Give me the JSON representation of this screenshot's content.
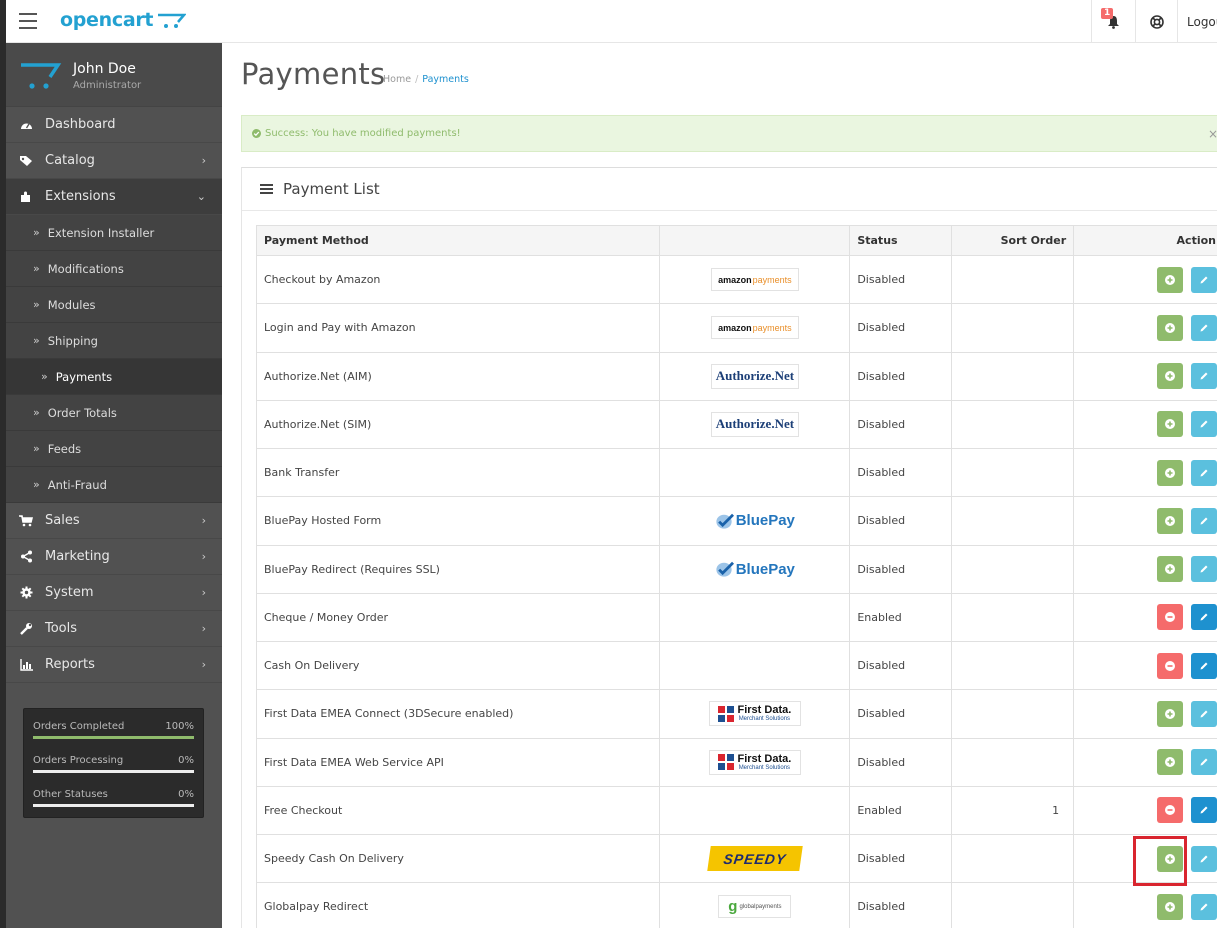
{
  "header": {
    "logo_text": "opencart",
    "notification_count": "1",
    "logout_label": "Logout"
  },
  "user": {
    "name": "John Doe",
    "role": "Administrator"
  },
  "sidebar": {
    "items": [
      {
        "label": "Dashboard",
        "icon": "dashboard-icon",
        "has_children": false
      },
      {
        "label": "Catalog",
        "icon": "tag-icon",
        "has_children": true
      },
      {
        "label": "Extensions",
        "icon": "puzzle-icon",
        "has_children": true,
        "open": true
      },
      {
        "label": "Sales",
        "icon": "cart-icon",
        "has_children": true
      },
      {
        "label": "Marketing",
        "icon": "share-icon",
        "has_children": true
      },
      {
        "label": "System",
        "icon": "cog-icon",
        "has_children": true
      },
      {
        "label": "Tools",
        "icon": "wrench-icon",
        "has_children": true
      },
      {
        "label": "Reports",
        "icon": "bar-chart-icon",
        "has_children": true
      }
    ],
    "extensions_sub": [
      {
        "label": "Extension Installer"
      },
      {
        "label": "Modifications"
      },
      {
        "label": "Modules"
      },
      {
        "label": "Shipping"
      },
      {
        "label": "Payments",
        "active": true
      },
      {
        "label": "Order Totals"
      },
      {
        "label": "Feeds"
      },
      {
        "label": "Anti-Fraud"
      }
    ]
  },
  "stats": [
    {
      "label": "Orders Completed",
      "value": "100%",
      "fraction": 1.0
    },
    {
      "label": "Orders Processing",
      "value": "0%",
      "fraction": 0.0
    },
    {
      "label": "Other Statuses",
      "value": "0%",
      "fraction": 0.0
    }
  ],
  "page": {
    "title": "Payments",
    "breadcrumb": [
      "Home",
      "Payments"
    ],
    "alert": "Success: You have modified payments!",
    "alert_close": "×",
    "panel_title": "Payment List"
  },
  "table": {
    "columns": [
      "Payment Method",
      "",
      "Status",
      "Sort Order",
      "Action"
    ],
    "rows": [
      {
        "name": "Checkout by Amazon",
        "logo": "amazon",
        "status": "Disabled",
        "sort": "",
        "installed": false
      },
      {
        "name": "Login and Pay with Amazon",
        "logo": "amazon",
        "status": "Disabled",
        "sort": "",
        "installed": false
      },
      {
        "name": "Authorize.Net (AIM)",
        "logo": "authnet",
        "status": "Disabled",
        "sort": "",
        "installed": false
      },
      {
        "name": "Authorize.Net (SIM)",
        "logo": "authnet",
        "status": "Disabled",
        "sort": "",
        "installed": false
      },
      {
        "name": "Bank Transfer",
        "logo": "",
        "status": "Disabled",
        "sort": "",
        "installed": false
      },
      {
        "name": "BluePay Hosted Form",
        "logo": "bluepay",
        "status": "Disabled",
        "sort": "",
        "installed": false
      },
      {
        "name": "BluePay Redirect (Requires SSL)",
        "logo": "bluepay",
        "status": "Disabled",
        "sort": "",
        "installed": false
      },
      {
        "name": "Cheque / Money Order",
        "logo": "",
        "status": "Enabled",
        "sort": "",
        "installed": true
      },
      {
        "name": "Cash On Delivery",
        "logo": "",
        "status": "Disabled",
        "sort": "",
        "installed": true
      },
      {
        "name": "First Data EMEA Connect (3DSecure enabled)",
        "logo": "firstdata",
        "status": "Disabled",
        "sort": "",
        "installed": false
      },
      {
        "name": "First Data EMEA Web Service API",
        "logo": "firstdata",
        "status": "Disabled",
        "sort": "",
        "installed": false
      },
      {
        "name": "Free Checkout",
        "logo": "",
        "status": "Enabled",
        "sort": "1",
        "installed": true
      },
      {
        "name": "Speedy Cash On Delivery",
        "logo": "speedy",
        "status": "Disabled",
        "sort": "",
        "installed": false,
        "highlighted": true
      },
      {
        "name": "Globalpay Redirect",
        "logo": "globalpay",
        "status": "Disabled",
        "sort": "",
        "installed": false
      }
    ]
  },
  "logos": {
    "amazon": {
      "brand": "amazon",
      "suffix": "payments"
    },
    "authnet": {
      "text": "Authorize.Net"
    },
    "bluepay": {
      "text": "BluePay"
    },
    "firstdata": {
      "text": "First Data.",
      "sub": "Merchant Solutions"
    },
    "speedy": {
      "text": "SPEEDY"
    },
    "globalpay": {
      "text": "globalpayments"
    }
  },
  "colors": {
    "accent": "#1e91cf",
    "install_green": "#8fbb6c",
    "uninstall_red": "#f56b6b",
    "edit_light": "#5bc0de",
    "edit_dark": "#1e91cf",
    "sidebar_bg": "#515151"
  }
}
